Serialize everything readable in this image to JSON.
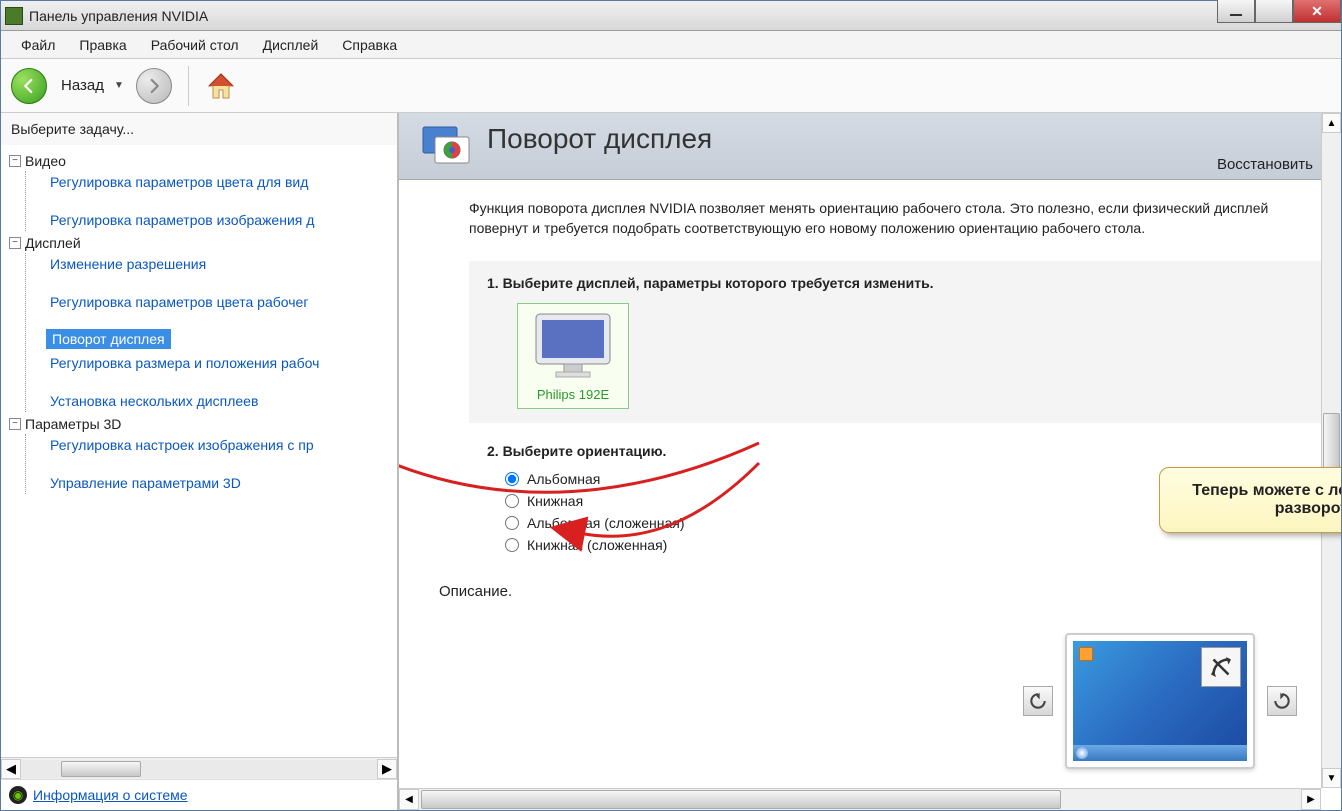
{
  "window": {
    "title": "Панель управления NVIDIA"
  },
  "menu": {
    "file": "Файл",
    "edit": "Правка",
    "desktop": "Рабочий стол",
    "display": "Дисплей",
    "help": "Справка"
  },
  "toolbar": {
    "back_label": "Назад"
  },
  "sidebar": {
    "header": "Выберите задачу...",
    "groups": [
      {
        "title": "Видео",
        "items": [
          "Регулировка параметров цвета для вид",
          "Регулировка параметров изображения д"
        ]
      },
      {
        "title": "Дисплей",
        "items": [
          "Изменение разрешения",
          "Регулировка параметров цвета рабочег",
          "Поворот дисплея",
          "Регулировка размера и положения рабоч",
          "Установка нескольких дисплеев"
        ],
        "selected_index": 2
      },
      {
        "title": "Параметры 3D",
        "items": [
          "Регулировка настроек изображения с пр",
          "Управление параметрами 3D"
        ]
      }
    ],
    "sysinfo_link": "Информация о системе"
  },
  "page": {
    "title": "Поворот дисплея",
    "restore": "Восстановить",
    "description": "Функция поворота дисплея NVIDIA позволяет менять ориентацию рабочего стола. Это полезно, если физический дисплей повернут и требуется подобрать соответствующую его новому положению ориентацию рабочего стола.",
    "step1": "1. Выберите дисплей, параметры которого требуется изменить.",
    "monitor_name": "Philips 192E",
    "step2": "2. Выберите ориентацию.",
    "orientations": [
      "Альбомная",
      "Книжная",
      "Альбомная (сложенная)",
      "Книжная (сложенная)"
    ],
    "selected_orientation": 0,
    "footer": "Описание."
  },
  "callout": {
    "text": "Теперь можете с легкостью выполнить разворот десплея!"
  }
}
